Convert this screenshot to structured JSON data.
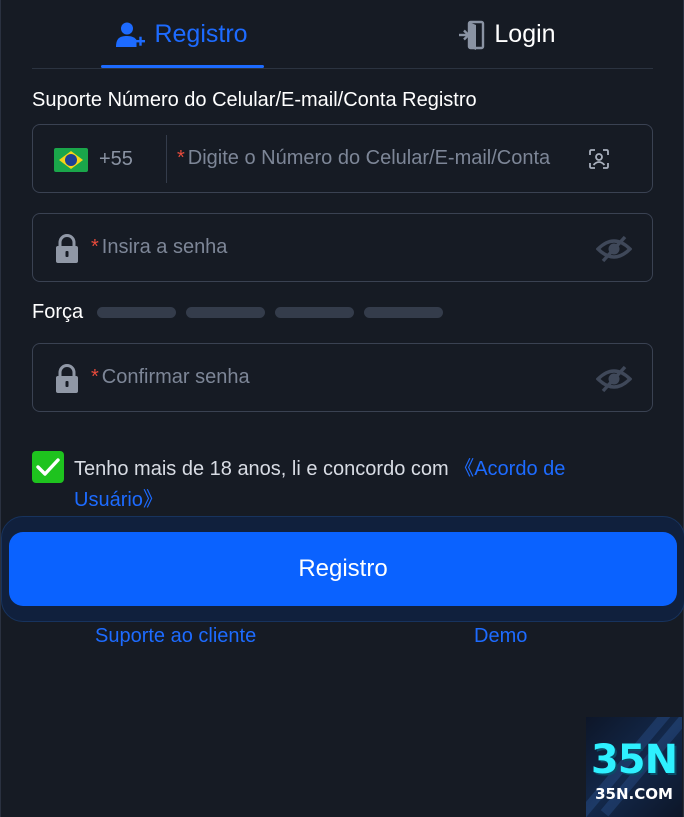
{
  "tabs": {
    "register_label": "Registro",
    "login_label": "Login",
    "active": "register"
  },
  "form": {
    "title": "Suporte Número do Celular/E-mail/Conta Registro",
    "phone": {
      "country_code": "+55",
      "flag": "brazil-flag",
      "placeholder": "Digite o Número do Celular/E-mail/Conta",
      "required_mark": "*"
    },
    "password": {
      "placeholder": "Insira a senha",
      "required_mark": "*"
    },
    "strength": {
      "label": "Força",
      "segments": 4,
      "level": 0
    },
    "confirm": {
      "placeholder": "Confirmar senha",
      "required_mark": "*"
    },
    "agreement": {
      "checked": true,
      "text": "Tenho mais de 18 anos, li e concordo com ",
      "link_text": "《Acordo de Usuário》"
    },
    "submit_label": "Registro"
  },
  "footer": {
    "support_label": "Suporte ao cliente",
    "demo_label": "Demo"
  },
  "logo": {
    "main": "35N",
    "sub": "35N.COM"
  },
  "colors": {
    "background": "#161b24",
    "accent": "#1d6bff",
    "button": "#0a62ff",
    "check": "#1ec31e",
    "required": "#e84b3c",
    "placeholder": "#7d8697",
    "border": "#3a4252"
  },
  "icons": {
    "register_tab": "user-plus-icon",
    "login_tab": "door-enter-icon",
    "scan": "face-scan-icon",
    "lock": "lock-icon",
    "eye": "eye-off-icon",
    "check": "check-icon"
  }
}
